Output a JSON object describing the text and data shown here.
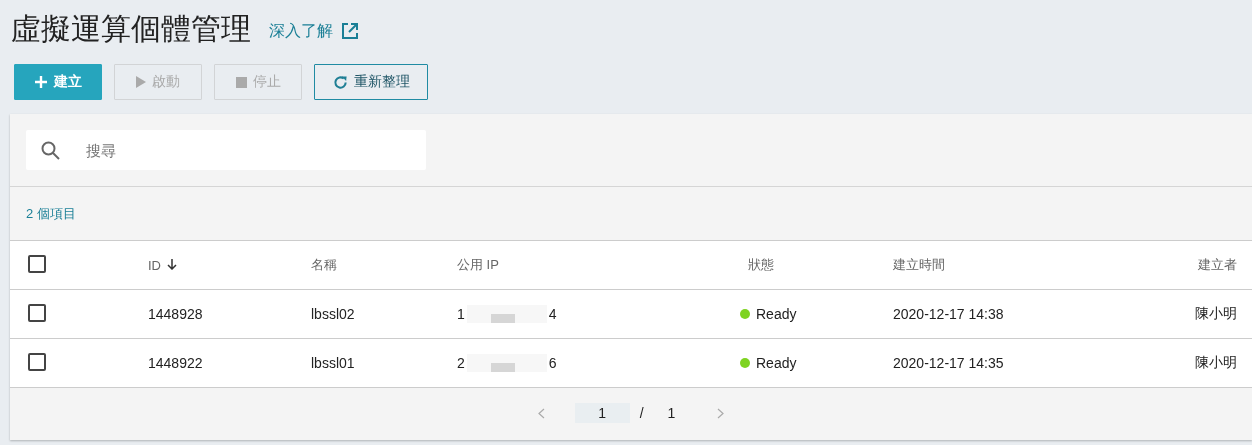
{
  "header": {
    "title": "虛擬運算個體管理",
    "learn_more": "深入了解"
  },
  "toolbar": [
    {
      "label": "建立",
      "kind": "plus",
      "disabled": false
    },
    {
      "label": "啟動",
      "kind": "play",
      "disabled": true
    },
    {
      "label": "停止",
      "kind": "stop",
      "disabled": true
    },
    {
      "label": "重新整理",
      "kind": "refresh",
      "disabled": false
    }
  ],
  "search": {
    "placeholder": "搜尋"
  },
  "item_count": "2 個項目",
  "table": {
    "select_all": {
      "checked": false
    },
    "columns": [
      {
        "label": "ID",
        "sorted": true
      },
      {
        "label": "名稱"
      },
      {
        "label": "公用 IP"
      },
      {
        "label": "狀態"
      },
      {
        "label": "建立時間"
      },
      {
        "label": "建立者"
      }
    ],
    "rows": [
      {
        "checked": false,
        "id": "1448928",
        "name": "lbssl02",
        "ip_start": "1",
        "ip_end": "4",
        "status": {
          "label": "Ready",
          "color": "#7ed321"
        },
        "created": "2020-12-17 14:38",
        "creator": "陳小明"
      },
      {
        "checked": false,
        "id": "1448922",
        "name": "lbssl01",
        "ip_start": "2",
        "ip_end": "6",
        "status": {
          "label": "Ready",
          "color": "#7ed321"
        },
        "created": "2020-12-17 14:35",
        "creator": "陳小明"
      }
    ]
  },
  "pagination": {
    "page": "1",
    "separator": "/",
    "total": "1",
    "prev_disabled": true,
    "next_disabled": true
  }
}
